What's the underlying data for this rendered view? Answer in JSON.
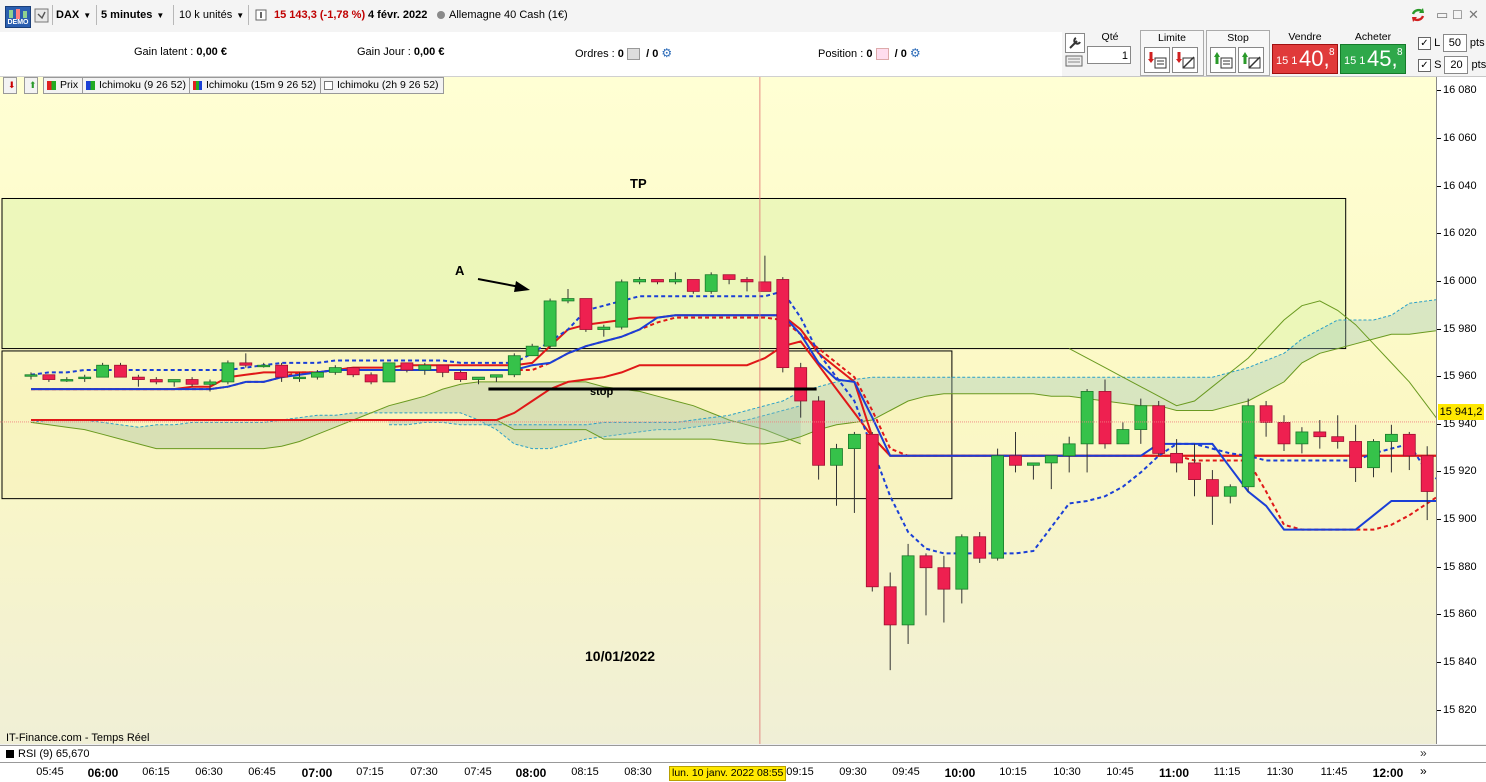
{
  "toolbar": {
    "demo_label": "DEMO",
    "instrument": "DAX",
    "timeframe": "5 minutes",
    "units": "10 k unités",
    "price_change": "15 143,3 (-1,78 %)",
    "date": "4 févr. 2022",
    "market": "Allemagne 40 Cash (1€)"
  },
  "account": {
    "gain_latent_label": "Gain latent :",
    "gain_latent_value": "0,00 €",
    "gain_jour_label": "Gain Jour :",
    "gain_jour_value": "0,00 €",
    "ordres_label": "Ordres :",
    "ordres_a": "0",
    "ordres_b": "/ 0",
    "position_label": "Position :",
    "position_a": "0",
    "position_b": "/ 0"
  },
  "order_panel": {
    "qty_label": "Qté",
    "qty_value": "1",
    "limit_label": "Limite",
    "stop_label": "Stop",
    "sell_label": "Vendre",
    "sell_small": "15 1",
    "sell_big": "40,",
    "sell_sup": "8",
    "buy_label": "Acheter",
    "buy_small": "15 1",
    "buy_big": "45,",
    "buy_sup": "8",
    "l_label": "L",
    "l_value": "50",
    "s_label": "S",
    "s_value": "20",
    "pts": "pts"
  },
  "indicators": [
    {
      "label": "Prix",
      "color": "#22aa22"
    },
    {
      "label": "Ichimoku (9 26 52)",
      "color": "#1a3fd6"
    },
    {
      "label": "Ichimoku (15m 9 26 52)",
      "color": "#22aa22"
    },
    {
      "label": "Ichimoku (2h 9 26 52)",
      "color": "#ffffff"
    }
  ],
  "annotations": {
    "tp": "TP",
    "stop": "stop",
    "a": "A",
    "date": "10/01/2022"
  },
  "source_label": "IT-Finance.com - Temps Réel",
  "rsi_label": "RSI (9) 65,670",
  "last_price_tag": "15 941,2",
  "cursor_date": "lun. 10 janv. 2022 08:55",
  "chart_data": {
    "type": "candlestick",
    "ylim": [
      15806,
      16086
    ],
    "y_ticks": [
      {
        "v": 16080,
        "label": "16 080"
      },
      {
        "v": 16060,
        "label": "16 060"
      },
      {
        "v": 16040,
        "label": "16 040"
      },
      {
        "v": 16020,
        "label": "16 020"
      },
      {
        "v": 16000,
        "label": "16 000"
      },
      {
        "v": 15980,
        "label": "15 980"
      },
      {
        "v": 15960,
        "label": "15 960"
      },
      {
        "v": 15940,
        "label": "15 940"
      },
      {
        "v": 15920,
        "label": "15 920"
      },
      {
        "v": 15900,
        "label": "15 900"
      },
      {
        "v": 15880,
        "label": "15 880"
      },
      {
        "v": 15860,
        "label": "15 860"
      },
      {
        "v": 15840,
        "label": "15 840"
      },
      {
        "v": 15820,
        "label": "15 820"
      }
    ],
    "x_ticks": [
      {
        "label": "05:45",
        "bold": false
      },
      {
        "label": "06:00",
        "bold": true
      },
      {
        "label": "06:15",
        "bold": false
      },
      {
        "label": "06:30",
        "bold": false
      },
      {
        "label": "06:45",
        "bold": false
      },
      {
        "label": "07:00",
        "bold": true
      },
      {
        "label": "07:15",
        "bold": false
      },
      {
        "label": "07:30",
        "bold": false
      },
      {
        "label": "07:45",
        "bold": false
      },
      {
        "label": "08:00",
        "bold": true
      },
      {
        "label": "08:15",
        "bold": false
      },
      {
        "label": "08:30",
        "bold": false
      },
      {
        "label": "09:15",
        "bold": false
      },
      {
        "label": "09:30",
        "bold": false
      },
      {
        "label": "09:45",
        "bold": false
      },
      {
        "label": "10:00",
        "bold": true
      },
      {
        "label": "10:15",
        "bold": false
      },
      {
        "label": "10:30",
        "bold": false
      },
      {
        "label": "10:45",
        "bold": false
      },
      {
        "label": "11:00",
        "bold": true
      },
      {
        "label": "11:15",
        "bold": false
      },
      {
        "label": "11:30",
        "bold": false
      },
      {
        "label": "11:45",
        "bold": false
      },
      {
        "label": "12:00",
        "bold": true
      }
    ],
    "candles": [
      [
        15961,
        15962,
        15959,
        15961
      ],
      [
        15961,
        15961,
        15958,
        15959
      ],
      [
        15959,
        15960,
        15958,
        15959
      ],
      [
        15960,
        15961,
        15958,
        15960
      ],
      [
        15960,
        15966,
        15960,
        15965
      ],
      [
        15965,
        15966,
        15960,
        15960
      ],
      [
        15960,
        15961,
        15956,
        15959
      ],
      [
        15959,
        15960,
        15957,
        15958
      ],
      [
        15958,
        15959,
        15956,
        15959
      ],
      [
        15959,
        15960,
        15956,
        15957
      ],
      [
        15957,
        15959,
        15954,
        15958
      ],
      [
        15958,
        15967,
        15957,
        15966
      ],
      [
        15966,
        15970,
        15964,
        15965
      ],
      [
        15965,
        15966,
        15964,
        15965
      ],
      [
        15965,
        15966,
        15958,
        15960
      ],
      [
        15960,
        15962,
        15958,
        15960
      ],
      [
        15960,
        15963,
        15959,
        15962
      ],
      [
        15962,
        15965,
        15961,
        15964
      ],
      [
        15964,
        15964,
        15960,
        15961
      ],
      [
        15961,
        15962,
        15957,
        15958
      ],
      [
        15958,
        15966,
        15958,
        15966
      ],
      [
        15966,
        15966,
        15962,
        15963
      ],
      [
        15963,
        15966,
        15961,
        15965
      ],
      [
        15965,
        15965,
        15960,
        15962
      ],
      [
        15962,
        15963,
        15958,
        15959
      ],
      [
        15959,
        15960,
        15957,
        15960
      ],
      [
        15960,
        15961,
        15958,
        15961
      ],
      [
        15961,
        15970,
        15960,
        15969
      ],
      [
        15969,
        15974,
        15969,
        15973
      ],
      [
        15973,
        15993,
        15972,
        15992
      ],
      [
        15992,
        15997,
        15991,
        15993
      ],
      [
        15993,
        15993,
        15979,
        15980
      ],
      [
        15980,
        15982,
        15977,
        15981
      ],
      [
        15981,
        16001,
        15980,
        16000
      ],
      [
        16000,
        16002,
        15999,
        16001
      ],
      [
        16001,
        16001,
        15999,
        16000
      ],
      [
        16000,
        16004,
        15999,
        16001
      ],
      [
        16001,
        16001,
        15995,
        15996
      ],
      [
        15996,
        16004,
        15995,
        16003
      ],
      [
        16003,
        16003,
        15999,
        16001
      ],
      [
        16001,
        16002,
        15996,
        16000
      ],
      [
        16000,
        16011,
        15996,
        15996
      ],
      [
        16001,
        16002,
        15962,
        15964
      ],
      [
        15964,
        15966,
        15943,
        15950
      ],
      [
        15950,
        15952,
        15917,
        15923
      ],
      [
        15923,
        15932,
        15906,
        15930
      ],
      [
        15930,
        15937,
        15903,
        15936
      ],
      [
        15936,
        15937,
        15870,
        15872
      ],
      [
        15872,
        15878,
        15837,
        15856
      ],
      [
        15856,
        15890,
        15848,
        15885
      ],
      [
        15885,
        15886,
        15860,
        15880
      ],
      [
        15880,
        15885,
        15857,
        15871
      ],
      [
        15871,
        15894,
        15865,
        15893
      ],
      [
        15893,
        15895,
        15882,
        15884
      ],
      [
        15884,
        15930,
        15883,
        15927
      ],
      [
        15927,
        15937,
        15920,
        15923
      ],
      [
        15923,
        15924,
        15917,
        15924
      ],
      [
        15924,
        15926,
        15913,
        15927
      ],
      [
        15927,
        15935,
        15920,
        15932
      ],
      [
        15932,
        15955,
        15920,
        15954
      ],
      [
        15954,
        15959,
        15930,
        15932
      ],
      [
        15932,
        15941,
        15932,
        15938
      ],
      [
        15938,
        15951,
        15932,
        15948
      ],
      [
        15948,
        15950,
        15927,
        15928
      ],
      [
        15928,
        15934,
        15920,
        15924
      ],
      [
        15924,
        15932,
        15910,
        15917
      ],
      [
        15917,
        15921,
        15898,
        15910
      ],
      [
        15910,
        15915,
        15907,
        15914
      ],
      [
        15914,
        15951,
        15912,
        15948
      ],
      [
        15948,
        15950,
        15935,
        15941
      ],
      [
        15941,
        15944,
        15929,
        15932
      ],
      [
        15932,
        15939,
        15928,
        15937
      ],
      [
        15937,
        15942,
        15930,
        15935
      ],
      [
        15935,
        15944,
        15930,
        15933
      ],
      [
        15933,
        15940,
        15916,
        15922
      ],
      [
        15922,
        15934,
        15918,
        15933
      ],
      [
        15933,
        15940,
        15920,
        15936
      ],
      [
        15936,
        15937,
        15921,
        15927
      ],
      [
        15927,
        15931,
        15900,
        15912
      ],
      [
        15912,
        15916,
        15900,
        15906
      ],
      [
        15906,
        15908,
        15893,
        15896
      ]
    ],
    "tenkan_fast": [
      15955,
      15955,
      15955,
      15955,
      15955,
      15955,
      15955,
      15955,
      15955,
      15956,
      15956,
      15960,
      15961,
      15962,
      15962,
      15962,
      15962,
      15963,
      15964,
      15964,
      15964,
      15965,
      15965,
      15965,
      15965,
      15965,
      15965,
      15965,
      15966,
      15973,
      15980,
      15982,
      15983,
      15984,
      15985,
      15985,
      15986,
      15986,
      15986,
      15986,
      15986,
      15986,
      15986,
      15980,
      15970,
      15964,
      15958,
      15935,
      15927,
      15927,
      15927,
      15927,
      15927,
      15927,
      15927,
      15927,
      15927,
      15927,
      15927,
      15927,
      15927,
      15927,
      15927,
      15927,
      15927,
      15927,
      15927,
      15927,
      15927,
      15927,
      15927,
      15927,
      15927,
      15927,
      15927,
      15927,
      15927,
      15927,
      15927,
      15927,
      15927
    ],
    "tenkan_blue": [
      15955,
      15955,
      15955,
      15955,
      15955,
      15955,
      15955,
      15955,
      15955,
      15955,
      15955,
      15956,
      15958,
      15958,
      15960,
      15961,
      15962,
      15963,
      15963,
      15963,
      15963,
      15963,
      15963,
      15963,
      15963,
      15963,
      15963,
      15963,
      15965,
      15966,
      15970,
      15973,
      15975,
      15977,
      15980,
      15985,
      15986,
      15986,
      15986,
      15986,
      15986,
      15986,
      15986,
      15978,
      15966,
      15959,
      15958,
      15943,
      15927,
      15927,
      15927,
      15927,
      15927,
      15927,
      15927,
      15927,
      15927,
      15927,
      15927,
      15927,
      15927,
      15927,
      15927,
      15932,
      15932,
      15932,
      15932,
      15922,
      15912,
      15906,
      15896,
      15896,
      15896,
      15896,
      15896,
      15902,
      15908,
      15908,
      15908,
      15908,
      15918,
      15922
    ],
    "kijun_red": [
      15942,
      15942,
      15942,
      15942,
      15942,
      15942,
      15942,
      15942,
      15942,
      15942,
      15942,
      15942,
      15942,
      15942,
      15942,
      15942,
      15942,
      15942,
      15942,
      15942,
      15942,
      15942,
      15942,
      15942,
      15942,
      15942,
      15942,
      15945,
      15950,
      15955,
      15958,
      15959,
      15960,
      15962,
      15965,
      15965,
      15965,
      15965,
      15965,
      15965,
      15965,
      15968,
      15973,
      15975,
      15965,
      15955,
      15945,
      15935,
      15927,
      15927,
      15927,
      15927,
      15927,
      15927,
      15927,
      15927,
      15927,
      15927,
      15927,
      15927,
      15927,
      15927,
      15927,
      15927,
      15927,
      15927,
      15927,
      15927,
      15927,
      15927,
      15927,
      15927,
      15927,
      15927,
      15927,
      15927,
      15927,
      15927,
      15927,
      15927,
      15927
    ],
    "kijun_red_dash": [
      15955,
      15955,
      15955,
      15955,
      15955,
      15955,
      15955,
      15955,
      15955,
      15955,
      15955,
      15956,
      15958,
      15958,
      15960,
      15962,
      15962,
      15963,
      15963,
      15963,
      15963,
      15963,
      15963,
      15963,
      15963,
      15963,
      15963,
      15963,
      15963,
      15966,
      15970,
      15973,
      15975,
      15977,
      15980,
      15983,
      15985,
      15985,
      15985,
      15985,
      15985,
      15985,
      15984,
      15978,
      15972,
      15966,
      15960,
      15946,
      15930,
      15927,
      15927,
      15927,
      15927,
      15927,
      15927,
      15927,
      15927,
      15927,
      15927,
      15927,
      15927,
      15927,
      15927,
      15927,
      15927,
      15925,
      15925,
      15925,
      15925,
      15912,
      15898,
      15896,
      15896,
      15896,
      15896,
      15896,
      15898,
      15902,
      15907,
      15912,
      15918,
      15920
    ],
    "kijun_blue_dash": [
      15961,
      15962,
      15962,
      15963,
      15963,
      15963,
      15963,
      15963,
      15963,
      15963,
      15963,
      15963,
      15964,
      15965,
      15966,
      15966,
      15966,
      15967,
      15967,
      15967,
      15967,
      15967,
      15967,
      15967,
      15966,
      15966,
      15966,
      15966,
      15970,
      15975,
      15980,
      15988,
      15990,
      15992,
      15994,
      15994,
      15994,
      15994,
      15994,
      15994,
      15994,
      15994,
      15996,
      15985,
      15970,
      15960,
      15950,
      15930,
      15910,
      15895,
      15888,
      15886,
      15886,
      15886,
      15886,
      15886,
      15887,
      15897,
      15907,
      15908,
      15910,
      15914,
      15920,
      15927,
      15932,
      15932,
      15930,
      15928,
      15927,
      15925,
      15925,
      15925,
      15925,
      15925,
      15925,
      15928,
      15930,
      15932,
      15920,
      15915,
      15912,
      15913
    ],
    "cloud_1_a": [
      15940,
      15940,
      15941,
      15941,
      15940,
      15940,
      15940,
      15940,
      15940,
      15940,
      15940,
      15940,
      15941,
      15941,
      15941,
      15941,
      15941,
      15942,
      15943,
      15944,
      15946,
      15948,
      15950,
      15954,
      15956,
      15958,
      15959,
      15960,
      15960,
      15960,
      15960,
      15960,
      15960,
      15960,
      15960,
      15960,
      15960,
      15960,
      15960,
      15960,
      15960,
      15960,
      15960,
      15960,
      15960,
      15960,
      15960,
      15962,
      15964,
      15967,
      15970,
      15976,
      15980,
      15984,
      15984,
      15984,
      15986,
      15991,
      15992,
      15993,
      15992,
      15990
    ],
    "cloud_1_b": [
      15942,
      15942,
      15942,
      15942,
      15942,
      15942,
      15942,
      15938,
      15938,
      15938,
      15938,
      15938,
      15934,
      15934,
      15934,
      15934,
      15934,
      15934,
      15934,
      15933,
      15932,
      15932,
      15933,
      15935,
      15938,
      15940,
      15941,
      15942,
      15946,
      15950,
      15952,
      15953,
      15953,
      15953,
      15953,
      15953,
      15953,
      15952,
      15952,
      15951,
      15950,
      15949,
      15948,
      15948,
      15946,
      15946,
      15946,
      15948,
      15950,
      15954,
      15958,
      15966,
      15970,
      15972,
      15974,
      15976,
      15978,
      15978,
      15979,
      15980,
      15980,
      15980
    ],
    "cloud_2_a": [
      15941,
      15942,
      15942,
      15942,
      15941,
      15940,
      15939,
      15940,
      15940,
      15941,
      15941,
      15941,
      15941,
      15941,
      15942,
      15943,
      15944,
      15944,
      15945,
      15945,
      15945,
      15945,
      15945,
      15945,
      15945,
      15942,
      15938,
      15932,
      15930,
      15930,
      15932,
      15934,
      15935,
      15936,
      15937,
      15938,
      15938,
      15939,
      15940,
      15941,
      15942,
      15944,
      15946,
      15948
    ],
    "cloud_2_b": [
      15941,
      15940,
      15939,
      15938,
      15936,
      15934,
      15932,
      15930,
      15930,
      15930,
      15930,
      15930,
      15930,
      15930,
      15931,
      15933,
      15936,
      15939,
      15942,
      15945,
      15948,
      15950,
      15952,
      15955,
      15957,
      15958,
      15958,
      15958,
      15958,
      15958,
      15958,
      15958,
      15956,
      15955,
      15954,
      15952,
      15950,
      15948,
      15945,
      15942,
      15940,
      15938,
      15935,
      15932
    ],
    "boxes": [
      {
        "name": "tp-zone",
        "y_top": 16035,
        "y_bottom": 15972,
        "from_candle": -2,
        "to_candle": 73
      },
      {
        "name": "entry-zone",
        "y_top": 15971,
        "y_bottom": 15909,
        "from_candle": -2,
        "to_candle": 51
      }
    ],
    "stop_line": {
      "y": 15955,
      "from_candle": 26,
      "to_candle": 44
    },
    "last_price": 15941.2,
    "cursor_candle": 41
  }
}
